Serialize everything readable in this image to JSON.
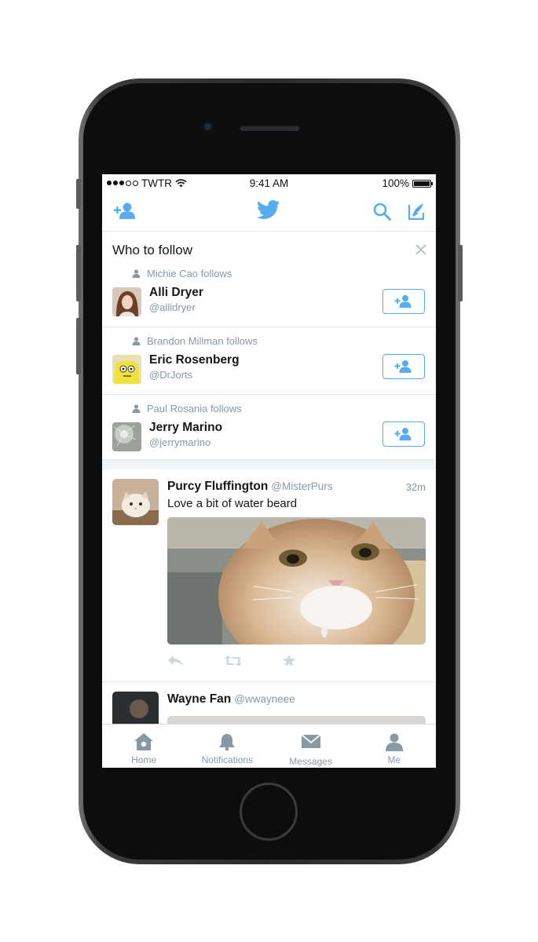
{
  "status_bar": {
    "carrier": "TWTR",
    "time": "9:41 AM",
    "battery": "100%"
  },
  "nav": {
    "icons": [
      "add-user-icon",
      "twitter-bird-icon",
      "search-icon",
      "compose-icon"
    ]
  },
  "who_to_follow": {
    "title": "Who to follow",
    "suggestions": [
      {
        "social_context": "Michie Cao follows",
        "name": "Alli Dryer",
        "handle": "@allidryer"
      },
      {
        "social_context": "Brandon Millman follows",
        "name": "Eric Rosenberg",
        "handle": "@DrJorts"
      },
      {
        "social_context": "Paul Rosania follows",
        "name": "Jerry Marino",
        "handle": "@jerrymarino"
      }
    ]
  },
  "tweets": [
    {
      "name": "Purcy Fluffington",
      "handle": "@MisterPurs",
      "time": "32m",
      "text": "Love a bit of water beard"
    },
    {
      "name": "Wayne Fan",
      "handle": "@wwayneee"
    }
  ],
  "tab_bar": {
    "tabs": [
      {
        "label": "Home",
        "icon": "home-icon"
      },
      {
        "label": "Notifications",
        "icon": "bell-icon"
      },
      {
        "label": "Messages",
        "icon": "envelope-icon"
      },
      {
        "label": "Me",
        "icon": "person-icon"
      }
    ]
  },
  "colors": {
    "accent": "#55acee",
    "secondary_text": "#8899a6",
    "tab_icon": "#8899a6",
    "divider": "#e1e8ed"
  }
}
